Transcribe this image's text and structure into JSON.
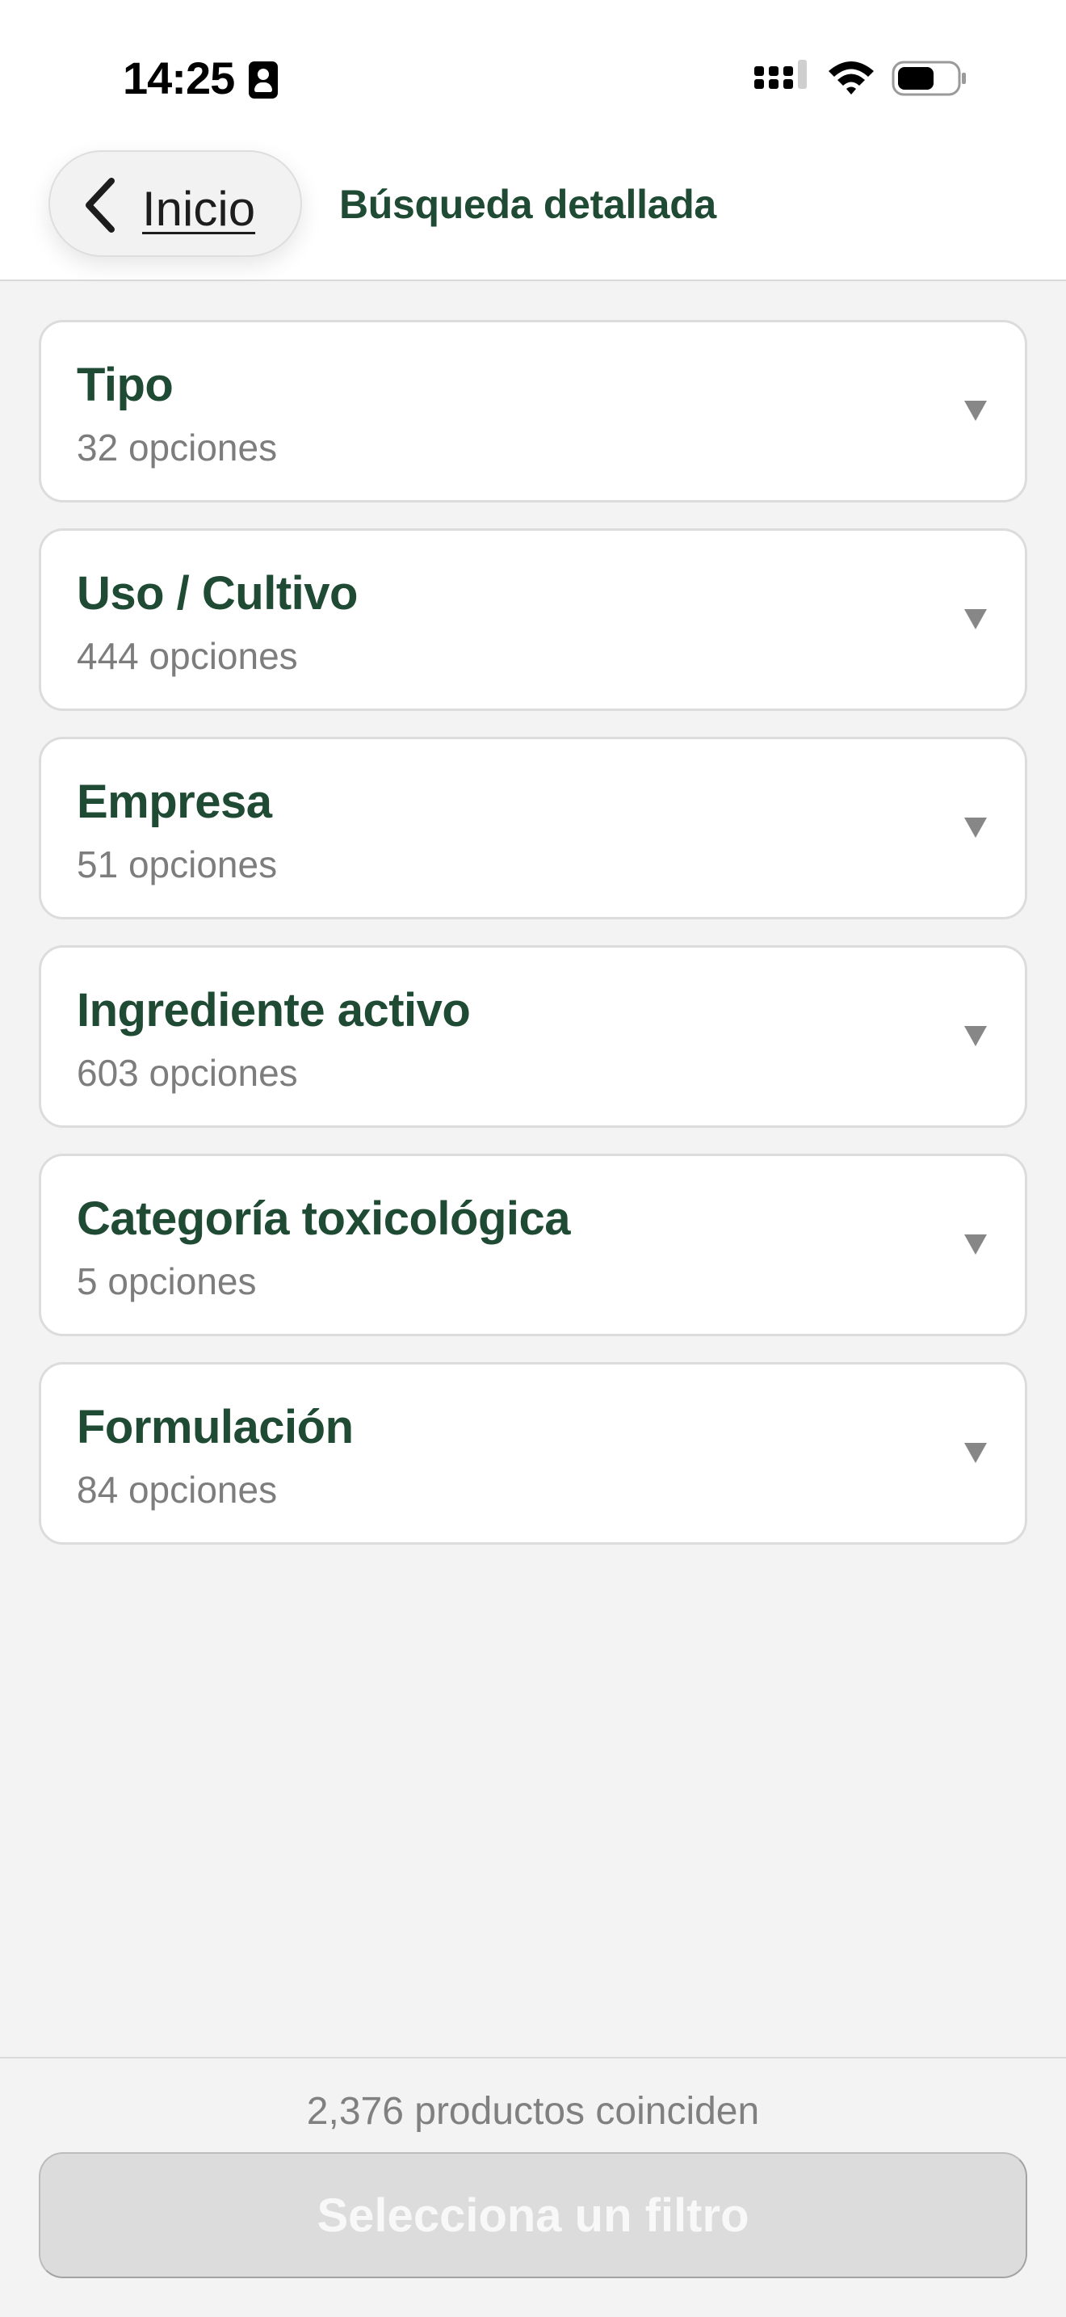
{
  "status_bar": {
    "time": "14:25",
    "icons": [
      "person-badge-icon",
      "cellular-signal-icon",
      "wifi-icon",
      "battery-icon"
    ]
  },
  "nav": {
    "back_label": "Inicio",
    "title": "Búsqueda detallada"
  },
  "filters": [
    {
      "label": "Tipo",
      "count": "32 opciones"
    },
    {
      "label": "Uso / Cultivo",
      "count": "444 opciones"
    },
    {
      "label": "Empresa",
      "count": "51 opciones"
    },
    {
      "label": "Ingrediente activo",
      "count": "603 opciones"
    },
    {
      "label": "Categoría toxicológica",
      "count": "5 opciones"
    },
    {
      "label": "Formulación",
      "count": "84 opciones"
    }
  ],
  "footer": {
    "match_count": "2,376 productos coinciden",
    "action_label": "Selecciona un filtro"
  },
  "colors": {
    "accent": "#1f4a33",
    "muted_text": "#7d7d7d",
    "background": "#f3f3f3",
    "disabled_button": "#dcdcdc"
  }
}
